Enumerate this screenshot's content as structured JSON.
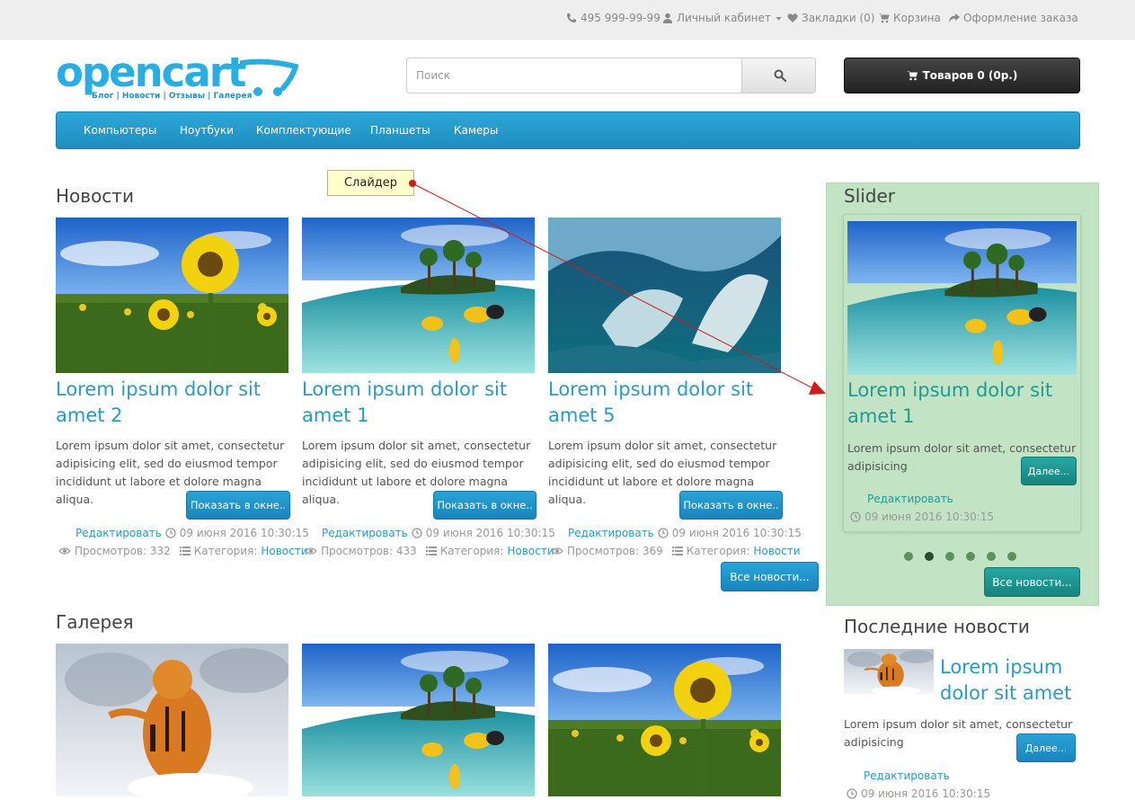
{
  "topbar": {
    "phone": "495 999-99-99",
    "account": "Личный кабинет",
    "wishlist": "Закладки (0)",
    "cart": "Корзина",
    "checkout": "Оформление заказа"
  },
  "logo": {
    "text": "opencart",
    "subtitle": "Блог | Новости | Отзывы | Галерея"
  },
  "search": {
    "placeholder": "Поиск"
  },
  "cart_button": {
    "label": "Товаров 0 (0р.)"
  },
  "menu": [
    "Компьютеры",
    "Ноутбуки",
    "Комплектующие",
    "Планшеты",
    "Камеры"
  ],
  "news": {
    "heading": "Новости",
    "items": [
      {
        "title": "Lorem ipsum dolor sit amet 2",
        "text": "Lorem ipsum dolor sit amet, consectetur adipisicing elit, sed do eiusmod tempor incididunt ut labore et dolore magna aliqua.",
        "button": "Показать в окне..",
        "edit": "Редактировать",
        "date": "09 июня 2016 10:30:15",
        "views": "Просмотров: 332",
        "category_label": "Категория:",
        "category": "Новости"
      },
      {
        "title": "Lorem ipsum dolor sit amet 1",
        "text": "Lorem ipsum dolor sit amet, consectetur adipisicing elit, sed do eiusmod tempor incididunt ut labore et dolore magna aliqua.",
        "button": "Показать в окне..",
        "edit": "Редактировать",
        "date": "09 июня 2016 10:30:15",
        "views": "Просмотров: 433",
        "category_label": "Категория:",
        "category": "Новости"
      },
      {
        "title": "Lorem ipsum dolor sit amet 5",
        "text": "Lorem ipsum dolor sit amet, consectetur adipisicing elit, sed do eiusmod tempor incididunt ut labore et dolore magna aliqua.",
        "button": "Показать в окне..",
        "edit": "Редактировать",
        "date": "09 июня 2016 10:30:15",
        "views": "Просмотров: 369",
        "category_label": "Категория:",
        "category": "Новости"
      }
    ],
    "all_button": "Все новости..."
  },
  "callout": {
    "label": "Слайдер"
  },
  "slider": {
    "heading": "Slider",
    "title": "Lorem ipsum dolor sit amet 1",
    "text": "Lorem ipsum dolor sit amet, consectetur adipisicing",
    "more": "Далее...",
    "edit": "Редактировать",
    "date": "09 июня 2016 10:30:15",
    "dots": 6,
    "active_dot": 2,
    "all_button": "Все новости..."
  },
  "gallery": {
    "heading": "Галерея"
  },
  "latest": {
    "heading": "Последние новости",
    "title": "Lorem ipsum dolor sit amet",
    "text": "Lorem ipsum dolor sit amet, consectetur adipisicing",
    "more": "Далее...",
    "edit": "Редактировать",
    "date": "09 июня 2016 10:30:15"
  },
  "colors": {
    "link": "#2a9bc9",
    "menu": "#1e8dc0",
    "slider_bg": "#c2e3c4",
    "teal_button": "#17847f"
  }
}
